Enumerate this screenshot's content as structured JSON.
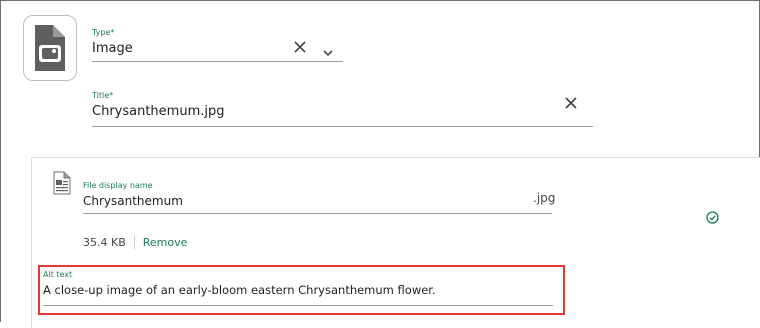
{
  "type_field": {
    "label": "Type*",
    "value": "Image",
    "icon": "image-file-icon"
  },
  "title_field": {
    "label": "Title*",
    "value": "Chrysanthemum.jpg"
  },
  "file": {
    "display_name_label": "File display name",
    "display_name_value": "Chrysanthemum",
    "extension": ".jpg",
    "size": "35.4 KB",
    "remove_label": "Remove",
    "status_icon": "check-circle-icon"
  },
  "alt_text": {
    "label": "Alt text",
    "value": "A close-up image of an early-bloom eastern Chrysanthemum flower."
  },
  "colors": {
    "accent_green": "#1b7a5a",
    "highlight_red": "#e53935"
  }
}
